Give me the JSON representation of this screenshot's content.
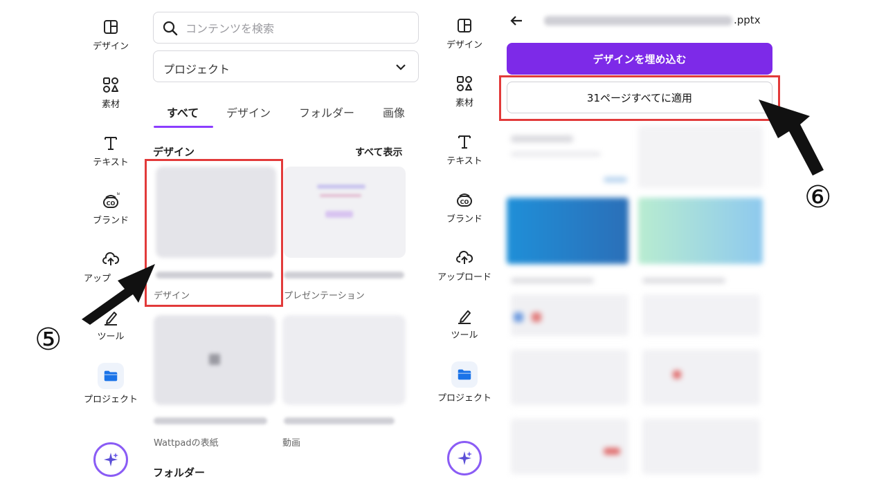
{
  "left_rail": {
    "items": [
      {
        "label": "デザイン",
        "icon": "layout-icon"
      },
      {
        "label": "素材",
        "icon": "shapes-icon"
      },
      {
        "label": "テキスト",
        "icon": "text-icon"
      },
      {
        "label": "ブランド",
        "icon": "brand-icon"
      },
      {
        "label": "アップ",
        "icon": "upload-icon"
      },
      {
        "label": "ツール",
        "icon": "draw-tool-icon"
      },
      {
        "label": "プロジェクト",
        "icon": "folder-icon"
      }
    ],
    "magic_icon": "sparkle-icon"
  },
  "left_panel": {
    "search": {
      "placeholder": "コンテンツを検索",
      "icon": "search-icon"
    },
    "filter": {
      "value": "プロジェクト",
      "icon": "chevron-down-icon"
    },
    "tabs": [
      {
        "label": "すべて",
        "active": true
      },
      {
        "label": "デザイン",
        "active": false
      },
      {
        "label": "フォルダー",
        "active": false
      },
      {
        "label": "画像",
        "active": false
      }
    ],
    "designs_section": {
      "title": "デザイン",
      "see_all": "すべて表示"
    },
    "cards": [
      {
        "type": "デザイン"
      },
      {
        "type": "プレゼンテーション"
      },
      {
        "type": "Wattpadの表紙"
      },
      {
        "type": "動画"
      }
    ],
    "folders_section": {
      "title": "フォルダー"
    }
  },
  "right_rail": {
    "items": [
      {
        "label": "デザイン",
        "icon": "layout-icon"
      },
      {
        "label": "素材",
        "icon": "shapes-icon"
      },
      {
        "label": "テキスト",
        "icon": "text-icon"
      },
      {
        "label": "ブランド",
        "icon": "brand-icon"
      },
      {
        "label": "アップロード",
        "icon": "upload-icon"
      },
      {
        "label": "ツール",
        "icon": "draw-tool-icon"
      },
      {
        "label": "プロジェクト",
        "icon": "folder-icon"
      }
    ],
    "magic_icon": "sparkle-icon"
  },
  "right_panel": {
    "file_title_suffix": ".pptx",
    "embed_button": "デザインを埋め込む",
    "apply_button": "31ページすべてに適用"
  },
  "annotations": {
    "step5": "⑤",
    "step6": "⑥"
  },
  "colors": {
    "accent": "#7d2ae8",
    "tab_underline": "#8b3dff",
    "highlight": "#e23a3a"
  }
}
